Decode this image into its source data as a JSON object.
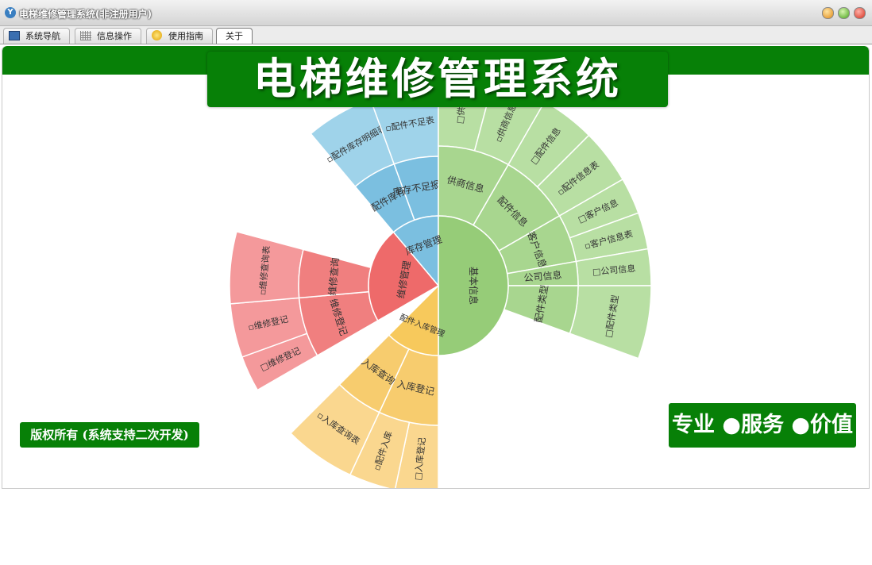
{
  "window": {
    "title": "电梯维修管理系统(非注册用户)",
    "app_icon": "app-logo-icon"
  },
  "tabs": [
    {
      "label": "系统导航",
      "icon": "monitor-icon"
    },
    {
      "label": "信息操作",
      "icon": "grid-icon"
    },
    {
      "label": "使用指南",
      "icon": "guide-icon"
    },
    {
      "label": "关于"
    }
  ],
  "active_tab": "关于",
  "banner": {
    "title": "电梯维修管理系统"
  },
  "footer": {
    "copyright": "版权所有 (系统支持二次开发)",
    "slogan": "专业 ●服务 ●价值"
  },
  "colors": {
    "brand_green": "#078007"
  },
  "sunburst": {
    "categories": [
      {
        "label": "库存管理",
        "color": "#7bbfe0",
        "children": [
          {
            "label": "配件库存",
            "children": [
              {
                "label": "▫配件库存明细表"
              }
            ]
          },
          {
            "label": "库存不足报警",
            "children": [
              {
                "label": "▫配件不足表"
              }
            ]
          }
        ]
      },
      {
        "label": "基本信息",
        "color": "#96cc78",
        "children": [
          {
            "label": "供商信息",
            "children": [
              {
                "label": "□供商"
              },
              {
                "label": "▫供商信息"
              }
            ]
          },
          {
            "label": "配件信息",
            "children": [
              {
                "label": "□配件信息"
              },
              {
                "label": "▫配件信息表"
              }
            ]
          },
          {
            "label": "客户信息",
            "children": [
              {
                "label": "□客户信息"
              },
              {
                "label": "▫客户信息表"
              }
            ]
          },
          {
            "label": "公司信息",
            "children": [
              {
                "label": "□公司信息"
              }
            ]
          },
          {
            "label": "配件类型",
            "children": [
              {
                "label": "□配件类型"
              }
            ]
          }
        ]
      },
      {
        "label": "配件入库管理",
        "color": "#f7c95c",
        "children": [
          {
            "label": "入库登记",
            "children": [
              {
                "label": "□入库登记"
              },
              {
                "label": "▫配件入库"
              }
            ]
          },
          {
            "label": "入库查询",
            "children": [
              {
                "label": "▫入库查询表"
              }
            ]
          }
        ]
      },
      {
        "label": "维修管理",
        "color": "#ee6a6a",
        "children": [
          {
            "label": "维修登记",
            "children": [
              {
                "label": "□维修登记"
              },
              {
                "label": "▫维修登记"
              }
            ]
          },
          {
            "label": "维修查询",
            "children": [
              {
                "label": "▫维修查询表"
              }
            ]
          }
        ]
      }
    ]
  }
}
